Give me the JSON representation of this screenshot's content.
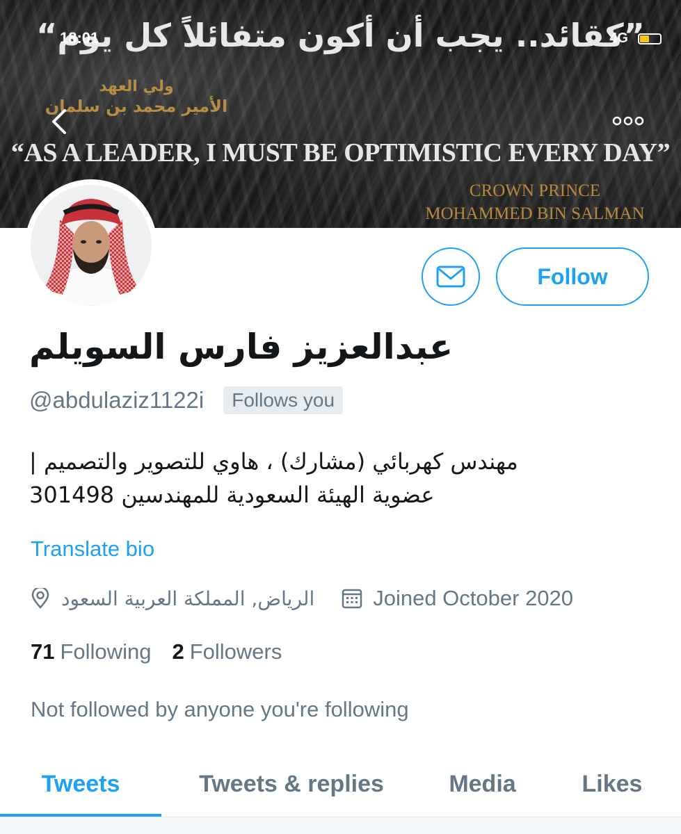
{
  "status_bar": {
    "time": "18:01",
    "network": "4G",
    "battery_level": 0.45,
    "battery_color": "#f6c417"
  },
  "banner": {
    "quote_ar": "”كقائد.. يجب أن أكون متفائلاً كل يوم“",
    "title_ar_line1": "ولي العهد",
    "title_ar_line2": "الأمير محمد بن سلمان",
    "quote_en": "“AS A LEADER, I MUST BE OPTIMISTIC EVERY DAY”",
    "credit_line1": "CROWN PRINCE",
    "credit_line2": "MOHAMMED BIN SALMAN",
    "back_icon": "chevron-left-icon",
    "more_icon": "more-dots-icon"
  },
  "profile": {
    "display_name": "عبدالعزيز فارس السويلم",
    "handle": "@abdulaziz1122i",
    "follows_you": "Follows you",
    "bio_line1": "مهندس كهربائي (مشارك) ، هاوي للتصوير والتصميم |",
    "bio_line2": "عضوية الهيئة السعودية للمهندسين 301498",
    "translate": "Translate bio",
    "location": "الرياض, المملكة العربية السعود",
    "joined": "Joined October 2020",
    "following_count": "71",
    "following_label": "Following",
    "followers_count": "2",
    "followers_label": "Followers",
    "not_followed": "Not followed by anyone you're following"
  },
  "actions": {
    "message_icon": "mail-icon",
    "follow_label": "Follow"
  },
  "tabs": [
    {
      "label": "Tweets",
      "active": true
    },
    {
      "label": "Tweets & replies",
      "active": false
    },
    {
      "label": "Media",
      "active": false
    },
    {
      "label": "Likes",
      "active": false
    }
  ],
  "colors": {
    "accent": "#1da1f2",
    "secondary_text": "#657786",
    "banner_gold": "#b58d45"
  }
}
